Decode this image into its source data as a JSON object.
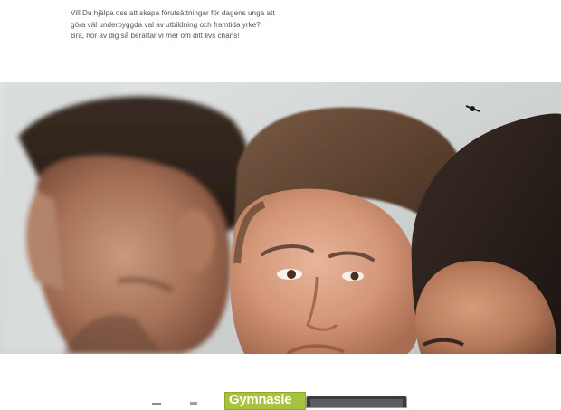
{
  "intro": {
    "lines": [
      "Vill Du hjälpa oss att skapa förutsättningar för dagens unga att",
      "göra väl underbyggda val av utbildning och framtida yrke?",
      "Bra, hör av dig så berättar vi mer om ditt livs chans!"
    ]
  },
  "hero": {
    "image_description_name": "three-young-people-photo"
  },
  "logo": {
    "text": "Gymnasie",
    "color": "#a7c23c"
  }
}
